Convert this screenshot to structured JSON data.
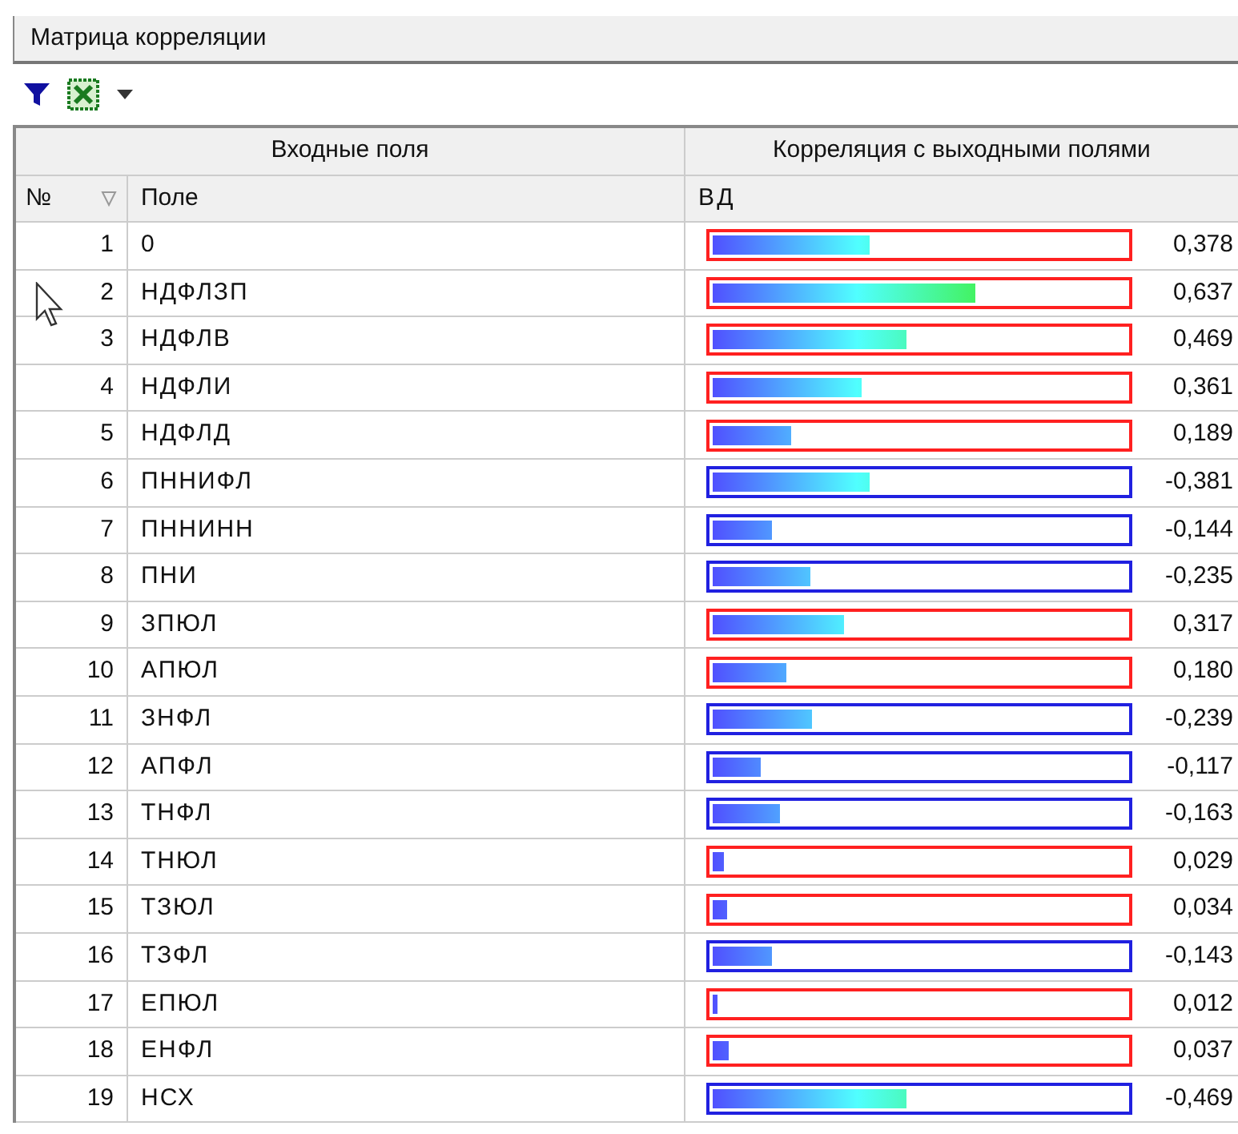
{
  "panel": {
    "title": "Матрица корреляции"
  },
  "table": {
    "group_headers": [
      "Входные поля",
      "Корреляция с выходными полями"
    ],
    "columns": [
      "№",
      "Поле",
      "ВД"
    ],
    "rows": [
      {
        "number": "1",
        "field": "0",
        "level": 0.378,
        "color": "#ff2020",
        "reading": "0,378"
      },
      {
        "number": "2",
        "field": "НДФЛЗП",
        "level": 0.637,
        "color": "#ff2020",
        "reading": "0,637"
      },
      {
        "number": "3",
        "field": "НДФЛВ",
        "level": 0.469,
        "color": "#ff2020",
        "reading": "0,469"
      },
      {
        "number": "4",
        "field": "НДФЛИ",
        "level": 0.361,
        "color": "#ff2020",
        "reading": "0,361"
      },
      {
        "number": "5",
        "field": "НДФЛД",
        "level": 0.189,
        "color": "#ff2020",
        "reading": "0,189"
      },
      {
        "number": "6",
        "field": "ПННИФЛ",
        "level": 0.381,
        "color": "#2020e0",
        "reading": "-0,381"
      },
      {
        "number": "7",
        "field": "ПННИНН",
        "level": 0.144,
        "color": "#2020e0",
        "reading": "-0,144"
      },
      {
        "number": "8",
        "field": "ПНИ",
        "level": 0.235,
        "color": "#2020e0",
        "reading": "-0,235"
      },
      {
        "number": "9",
        "field": "ЗПЮЛ",
        "level": 0.317,
        "color": "#ff2020",
        "reading": "0,317"
      },
      {
        "number": "10",
        "field": "АПЮЛ",
        "level": 0.18,
        "color": "#ff2020",
        "reading": "0,180"
      },
      {
        "number": "11",
        "field": "ЗНФЛ",
        "level": 0.239,
        "color": "#2020e0",
        "reading": "-0,239"
      },
      {
        "number": "12",
        "field": "АПФЛ",
        "level": 0.117,
        "color": "#2020e0",
        "reading": "-0,117"
      },
      {
        "number": "13",
        "field": "ТНФЛ",
        "level": 0.163,
        "color": "#2020e0",
        "reading": "-0,163"
      },
      {
        "number": "14",
        "field": "ТНЮЛ",
        "level": 0.029,
        "color": "#ff2020",
        "reading": "0,029"
      },
      {
        "number": "15",
        "field": "ТЗЮЛ",
        "level": 0.034,
        "color": "#ff2020",
        "reading": "0,034"
      },
      {
        "number": "16",
        "field": "ТЗФЛ",
        "level": 0.143,
        "color": "#2020e0",
        "reading": "-0,143"
      },
      {
        "number": "17",
        "field": "ЕПЮЛ",
        "level": 0.012,
        "color": "#ff2020",
        "reading": "0,012"
      },
      {
        "number": "18",
        "field": "ЕНФЛ",
        "level": 0.037,
        "color": "#ff2020",
        "reading": "0,037"
      },
      {
        "number": "19",
        "field": "НСХ",
        "level": 0.469,
        "color": "#2020e0",
        "reading": "-0,469"
      }
    ]
  }
}
